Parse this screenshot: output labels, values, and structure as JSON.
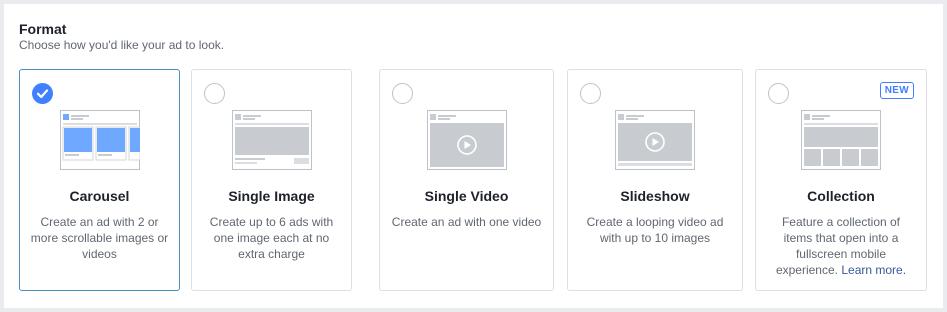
{
  "format": {
    "title": "Format",
    "subtitle": "Choose how you'd like your ad to look."
  },
  "cards": [
    {
      "id": "carousel",
      "title": "Carousel",
      "description": "Create an ad with 2 or more scrollable images or videos",
      "selected": true,
      "icon": "carousel-preview-icon"
    },
    {
      "id": "single-image",
      "title": "Single Image",
      "description": "Create up to 6 ads with one image each at no extra charge",
      "selected": false,
      "icon": "single-image-preview-icon"
    },
    {
      "id": "single-video",
      "title": "Single Video",
      "description": "Create an ad with one video",
      "selected": false,
      "icon": "single-video-preview-icon"
    },
    {
      "id": "slideshow",
      "title": "Slideshow",
      "description": "Create a looping video ad with up to 10 images",
      "selected": false,
      "icon": "slideshow-preview-icon"
    },
    {
      "id": "collection",
      "title": "Collection",
      "description": "Feature a collection of items that open into a fullscreen mobile experience.",
      "link_text": "Learn more.",
      "badge": "NEW",
      "selected": false,
      "icon": "collection-preview-icon"
    }
  ],
  "colors": {
    "accent": "#4080ff",
    "selected_border": "#4a90c2",
    "link": "#365899",
    "preview_blue": "#6fa8ff",
    "preview_grey": "#c8ccd1"
  }
}
